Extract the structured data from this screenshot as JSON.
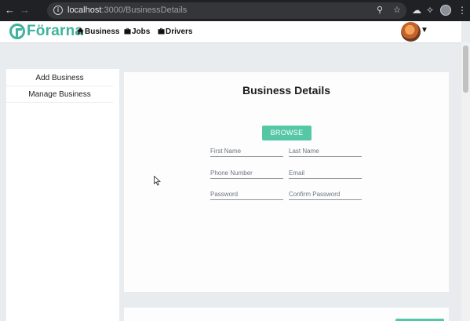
{
  "browser": {
    "url_host": "localhost",
    "url_path": ":3000/BusinessDetails"
  },
  "app": {
    "logo_text": "Förarna",
    "nav": [
      {
        "label": "Business"
      },
      {
        "label": "Jobs"
      },
      {
        "label": "Drivers"
      }
    ]
  },
  "sidebar": {
    "items": [
      {
        "label": "Add Business"
      },
      {
        "label": "Manage Business"
      }
    ]
  },
  "main": {
    "title": "Business Details",
    "browse_label": "BROWSE",
    "fields": {
      "first_name": {
        "placeholder": "First Name",
        "value": ""
      },
      "last_name": {
        "placeholder": "Last Name",
        "value": ""
      },
      "phone": {
        "placeholder": "Phone Number",
        "value": ""
      },
      "email": {
        "placeholder": "Email",
        "value": ""
      },
      "password": {
        "placeholder": "Password",
        "value": ""
      },
      "confirm_password": {
        "placeholder": "Confirm Password",
        "value": ""
      }
    }
  },
  "colors": {
    "brand": "#3fb39b",
    "button": "#55c7a4",
    "page_bg": "#e9ecef",
    "chrome_bg": "#202124"
  },
  "icons": {
    "business": "home-icon",
    "jobs": "briefcase-icon",
    "drivers": "briefcase-icon",
    "avatar_menu": "chevron-down-icon"
  }
}
